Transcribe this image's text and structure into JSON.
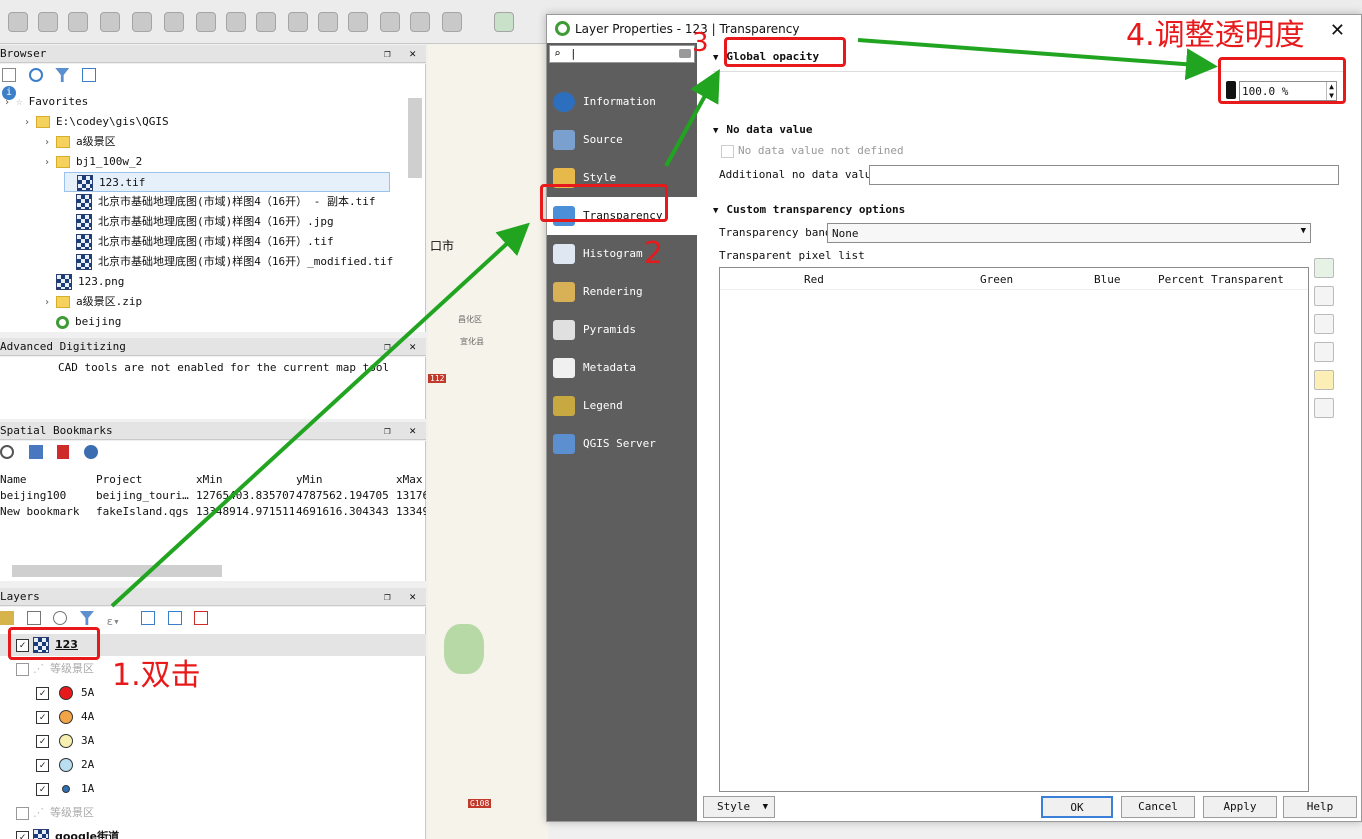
{
  "browser": {
    "title": "Browser",
    "dock_btns": "❐ ✕",
    "tree": [
      {
        "label": "Favorites",
        "indent": 0,
        "icon": "star-icon"
      },
      {
        "label": "E:\\codey\\gis\\QGIS",
        "indent": 1,
        "icon": "folder-icon"
      },
      {
        "label": "a级景区",
        "indent": 2,
        "icon": "folder-icon"
      },
      {
        "label": "bj1_100w_2",
        "indent": 2,
        "icon": "folder-icon"
      },
      {
        "label": "123.tif",
        "indent": 3,
        "icon": "raster-icon",
        "selected": true
      },
      {
        "label": "北京市基础地理底图(市域)样图4（16开） - 副本.tif",
        "indent": 3,
        "icon": "raster-icon"
      },
      {
        "label": "北京市基础地理底图(市域)样图4（16开）.jpg",
        "indent": 3,
        "icon": "raster-icon"
      },
      {
        "label": "北京市基础地理底图(市域)样图4（16开）.tif",
        "indent": 3,
        "icon": "raster-icon"
      },
      {
        "label": "北京市基础地理底图(市域)样图4（16开）_modified.tif",
        "indent": 3,
        "icon": "raster-icon"
      },
      {
        "label": "123.png",
        "indent": 2,
        "icon": "raster-icon"
      },
      {
        "label": "a级景区.zip",
        "indent": 2,
        "icon": "zip-icon"
      },
      {
        "label": "beijing",
        "indent": 2,
        "icon": "qgis-project-icon"
      }
    ]
  },
  "advanced_digitizing": {
    "title": "Advanced Digitizing",
    "message": "CAD tools are not enabled for the current map tool"
  },
  "bookmarks": {
    "title": "Spatial Bookmarks",
    "columns": [
      "Name",
      "Project",
      "xMin",
      "yMin",
      "xMax"
    ],
    "rows": [
      [
        "beijing100",
        "beijing_touri…",
        "12765403.835707",
        "4787562.194705",
        "13176"
      ],
      [
        "New bookmark",
        "fakeIsland.qgs",
        "13348914.971511",
        "4691616.304343",
        "13349"
      ]
    ]
  },
  "layers": {
    "title": "Layers",
    "items": [
      {
        "label": "123",
        "checked": true,
        "kind": "raster",
        "bold": true
      },
      {
        "label": "等级景区",
        "checked": false,
        "kind": "group",
        "muted": true
      },
      {
        "label": "5A",
        "checked": true,
        "kind": "legend",
        "color": "#e8191b"
      },
      {
        "label": "4A",
        "checked": true,
        "kind": "legend",
        "color": "#f2a447"
      },
      {
        "label": "3A",
        "checked": true,
        "kind": "legend",
        "color": "#f5f0b0"
      },
      {
        "label": "2A",
        "checked": true,
        "kind": "legend",
        "color": "#b8def0"
      },
      {
        "label": "1A",
        "checked": true,
        "kind": "legend",
        "color": "#2f6fb5",
        "small": true
      },
      {
        "label": "等级景区",
        "checked": false,
        "kind": "group",
        "muted": true
      },
      {
        "label": "google街道",
        "checked": true,
        "kind": "raster",
        "bold": true
      }
    ]
  },
  "map_labels": [
    "口市",
    "昌化区",
    "宣化县",
    "112",
    "G108"
  ],
  "dialog": {
    "title": "Layer Properties - 123 | Transparency",
    "close": "✕",
    "search_value": "|",
    "nav": [
      {
        "label": "Information",
        "icon": "info-icon",
        "color": "#2d6fbf"
      },
      {
        "label": "Source",
        "icon": "source-gear-icon",
        "color": "#7aa0d0"
      },
      {
        "label": "Style",
        "icon": "paintbrush-icon",
        "color": "#e7b84a"
      },
      {
        "label": "Transparency",
        "icon": "transparency-icon",
        "color": "#4a8fd8",
        "active": true
      },
      {
        "label": "Histogram",
        "icon": "histogram-icon",
        "color": "#dfe8f2"
      },
      {
        "label": "Rendering",
        "icon": "brush-icon",
        "color": "#d8b055"
      },
      {
        "label": "Pyramids",
        "icon": "pyramid-icon",
        "color": "#e0e0e0"
      },
      {
        "label": "Metadata",
        "icon": "metadata-icon",
        "color": "#f0f0f0"
      },
      {
        "label": "Legend",
        "icon": "legend-icon",
        "color": "#c8a840"
      },
      {
        "label": "QGIS Server",
        "icon": "server-icon",
        "color": "#5c8fd0"
      }
    ],
    "global_opacity": {
      "heading": "Global opacity",
      "value": "100.0 %",
      "level": 1.0
    },
    "no_data": {
      "heading": "No data value",
      "checkbox_label": "No data value  not defined",
      "additional_label": "Additional no data value",
      "additional_value": ""
    },
    "custom": {
      "heading": "Custom transparency options",
      "band_label": "Transparency band",
      "band_value": "None",
      "list_label": "Transparent pixel list",
      "columns": [
        "Red",
        "Green",
        "Blue",
        "Percent Transparent"
      ]
    },
    "buttons": {
      "style": "Style",
      "ok": "OK",
      "cancel": "Cancel",
      "apply": "Apply",
      "help": "Help"
    }
  },
  "annotations": {
    "step1": "1.双击",
    "step2": "2",
    "step3": "3",
    "step4": "4.调整透明度",
    "arrow_color": "#21a521",
    "highlight_color": "#e8191b"
  }
}
